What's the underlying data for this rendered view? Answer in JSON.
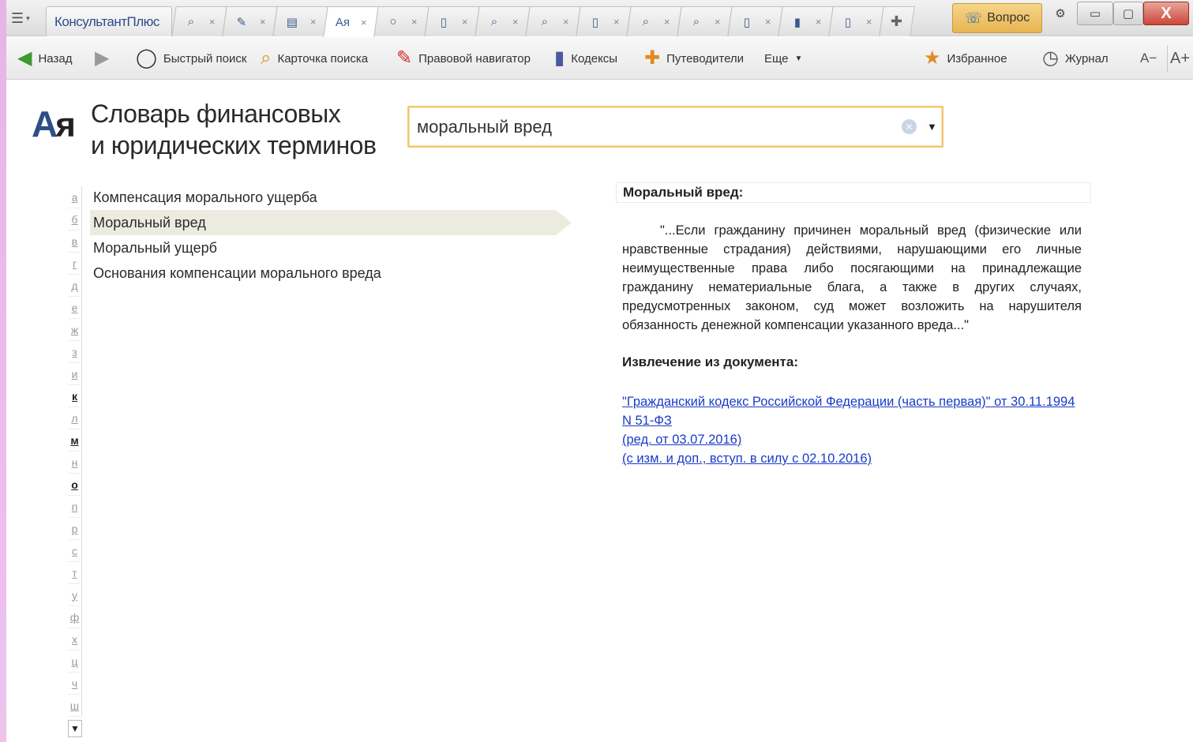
{
  "app": {
    "brand": "КонсультантПлюс"
  },
  "tabs": [
    {
      "icon": "search-card-icon",
      "glyph": "⌕",
      "close": "×",
      "active": false
    },
    {
      "icon": "navigator-icon",
      "glyph": "✎",
      "close": "×",
      "active": false
    },
    {
      "icon": "document-icon",
      "glyph": "▤",
      "close": "×",
      "active": false
    },
    {
      "icon": "dictionary-icon",
      "glyph": "Ая",
      "close": "×",
      "active": true
    },
    {
      "icon": "quick-search-icon",
      "glyph": "○",
      "close": "×",
      "active": false
    },
    {
      "icon": "document-icon",
      "glyph": "▯",
      "close": "×",
      "active": false
    },
    {
      "icon": "search-card-icon",
      "glyph": "⌕",
      "close": "×",
      "active": false
    },
    {
      "icon": "search-card-icon",
      "glyph": "⌕",
      "close": "×",
      "active": false
    },
    {
      "icon": "document-icon",
      "glyph": "▯",
      "close": "×",
      "active": false
    },
    {
      "icon": "search-card-icon",
      "glyph": "⌕",
      "close": "×",
      "active": false
    },
    {
      "icon": "search-card-icon",
      "glyph": "⌕",
      "close": "×",
      "active": false
    },
    {
      "icon": "document-icon",
      "glyph": "▯",
      "close": "×",
      "active": false
    },
    {
      "icon": "codex-icon",
      "glyph": "▮",
      "close": "×",
      "active": false
    },
    {
      "icon": "document-icon",
      "glyph": "▯",
      "close": "×",
      "active": false
    }
  ],
  "window": {
    "question_label": "Вопрос"
  },
  "toolbar": {
    "back": "Назад",
    "quick_search": "Быстрый поиск",
    "search_card": "Карточка поиска",
    "legal_navigator": "Правовой навигатор",
    "codes": "Кодексы",
    "guides": "Путеводители",
    "more": "Еще",
    "favorites": "Избранное",
    "journal": "Журнал",
    "font_smaller": "A−",
    "font_larger": "A+"
  },
  "page": {
    "logo_a": "А",
    "logo_b": "я",
    "title_line1": "Словарь финансовых",
    "title_line2": "и юридических терминов"
  },
  "search": {
    "value": "моральный вред"
  },
  "alphabet": [
    {
      "letter": "а",
      "on": false
    },
    {
      "letter": "б",
      "on": false
    },
    {
      "letter": "в",
      "on": false
    },
    {
      "letter": "г",
      "on": false
    },
    {
      "letter": "д",
      "on": false
    },
    {
      "letter": "е",
      "on": false
    },
    {
      "letter": "ж",
      "on": false
    },
    {
      "letter": "з",
      "on": false
    },
    {
      "letter": "и",
      "on": false
    },
    {
      "letter": "к",
      "on": true
    },
    {
      "letter": "л",
      "on": false
    },
    {
      "letter": "м",
      "on": true
    },
    {
      "letter": "н",
      "on": false
    },
    {
      "letter": "о",
      "on": true
    },
    {
      "letter": "п",
      "on": false
    },
    {
      "letter": "р",
      "on": false
    },
    {
      "letter": "с",
      "on": false
    },
    {
      "letter": "т",
      "on": false
    },
    {
      "letter": "у",
      "on": false
    },
    {
      "letter": "ф",
      "on": false
    },
    {
      "letter": "х",
      "on": false
    },
    {
      "letter": "ц",
      "on": false
    },
    {
      "letter": "ч",
      "on": false
    },
    {
      "letter": "ш",
      "on": false
    }
  ],
  "terms": [
    {
      "label": "Компенсация морального ущерба",
      "selected": false
    },
    {
      "label": "Моральный вред",
      "selected": true
    },
    {
      "label": "Моральный ущерб",
      "selected": false
    },
    {
      "label": "Основания компенсации морального вреда",
      "selected": false
    }
  ],
  "definition": {
    "header": "Моральный вред:",
    "text": "\"...Если гражданину причинен моральный вред (физические или нравственные страдания) действиями, нарушающими его личные неимущественные права либо посягающими на принадлежащие гражданину нематериальные блага, а также в других случаях, предусмотренных законом, суд может возложить на нарушителя обязанность денежной компенсации указанного вреда...\"",
    "extract_title": "Извлечение из документа:",
    "link_lines": [
      "\"Гражданский кодекс Российской Федерации (часть первая)\" от 30.11.1994",
      "N 51-ФЗ",
      "(ред. от 03.07.2016)",
      "(с изм. и доп., вступ. в силу с 02.10.2016)"
    ]
  }
}
